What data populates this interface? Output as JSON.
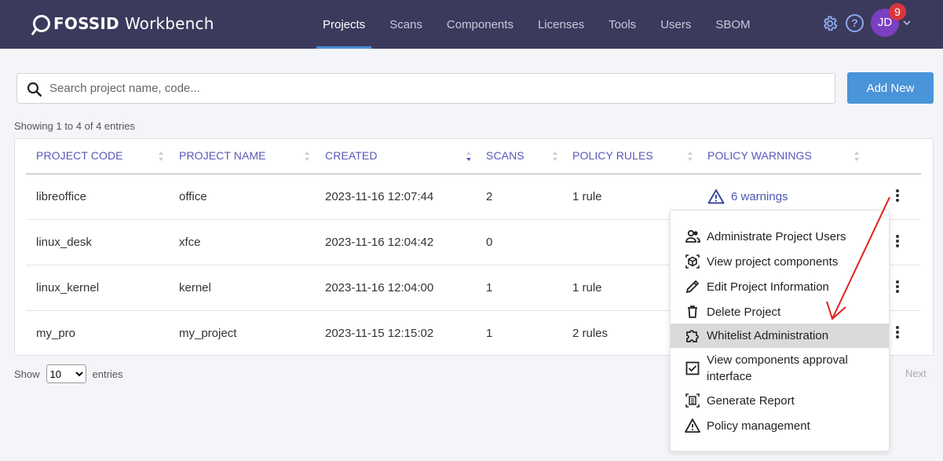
{
  "brand": {
    "fossid": "FOSSID",
    "workbench": "Workbench"
  },
  "nav": [
    {
      "label": "Projects",
      "active": true
    },
    {
      "label": "Scans"
    },
    {
      "label": "Components"
    },
    {
      "label": "Licenses"
    },
    {
      "label": "Tools"
    },
    {
      "label": "Users"
    },
    {
      "label": "SBOM"
    }
  ],
  "user": {
    "initials": "JD",
    "notifications": "9"
  },
  "help_glyph": "?",
  "search": {
    "placeholder": "Search project name, code..."
  },
  "add_new": "Add New",
  "showing": "Showing 1 to 4 of 4 entries",
  "columns": [
    "PROJECT CODE",
    "PROJECT NAME",
    "CREATED",
    "SCANS",
    "POLICY RULES",
    "POLICY WARNINGS"
  ],
  "rows": [
    {
      "code": "libreoffice",
      "name": "office",
      "created": "2023-11-16 12:07:44",
      "scans": "2",
      "rules": "1 rule",
      "warnings": "6 warnings"
    },
    {
      "code": "linux_desk",
      "name": "xfce",
      "created": "2023-11-16 12:04:42",
      "scans": "0",
      "rules": "",
      "warnings": ""
    },
    {
      "code": "linux_kernel",
      "name": "kernel",
      "created": "2023-11-16 12:04:00",
      "scans": "1",
      "rules": "1 rule",
      "warnings": ""
    },
    {
      "code": "my_pro",
      "name": "my_project",
      "created": "2023-11-15 12:15:02",
      "scans": "1",
      "rules": "2 rules",
      "warnings": ""
    }
  ],
  "pagination": {
    "show": "Show",
    "entries": "entries",
    "page_size": "10",
    "next": "Next"
  },
  "menu": [
    {
      "label": "Administrate Project Users",
      "icon": "users-icon"
    },
    {
      "label": "View project components",
      "icon": "cube-icon"
    },
    {
      "label": "Edit Project Information",
      "icon": "pencil-icon"
    },
    {
      "label": "Delete Project",
      "icon": "trash-icon"
    },
    {
      "label": "Whitelist Administration",
      "icon": "puzzle-icon",
      "highlighted": true
    },
    {
      "label": "View components approval interface",
      "icon": "checkbox-icon"
    },
    {
      "label": "Generate Report",
      "icon": "report-icon"
    },
    {
      "label": "Policy management",
      "icon": "warning-icon"
    }
  ],
  "colors": {
    "topbar": "#3b3a5c",
    "accent": "#4a94d9",
    "header_text": "#5a56b8",
    "badge": "#d9363e",
    "avatar": "#7b3fc1",
    "annotation_arrow": "#e0201e"
  }
}
